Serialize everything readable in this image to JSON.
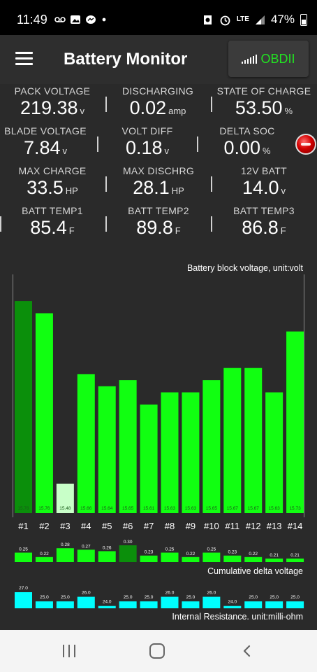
{
  "status_bar": {
    "time": "11:49",
    "left_icons": [
      "voicemail-icon",
      "gallery-icon",
      "messenger-icon",
      "dot-icon"
    ],
    "right_icons": [
      "alarm-icon",
      "alarm-clock-icon",
      "lte-icon",
      "signal-icon"
    ],
    "lte_label": "LTE",
    "battery_percent": "47%"
  },
  "app_bar": {
    "title": "Battery Monitor",
    "obd_button_label": "OBDII",
    "obd_color": "#22e222"
  },
  "stats": {
    "pack_voltage": {
      "label": "PACK VOLTAGE",
      "value": "219.38",
      "unit": "v"
    },
    "discharging": {
      "label": "DISCHARGING",
      "value": "0.02",
      "unit": "amp"
    },
    "state_of_charge": {
      "label": "STATE OF CHARGE",
      "value": "53.50",
      "unit": "%"
    },
    "blade_voltage": {
      "label": "BLADE VOLTAGE",
      "value": "7.84",
      "unit": "v"
    },
    "volt_diff": {
      "label": "VOLT DIFF",
      "value": "0.18",
      "unit": "v"
    },
    "delta_soc": {
      "label": "DELTA SOC",
      "value": "0.00",
      "unit": "%"
    },
    "max_charge": {
      "label": "MAX CHARGE",
      "value": "33.5",
      "unit": "HP"
    },
    "max_dischrg": {
      "label": "MAX DISCHRG",
      "value": "28.1",
      "unit": "HP"
    },
    "batt_12v": {
      "label": "12V BATT",
      "value": "14.0",
      "unit": "v"
    },
    "batt_temp1": {
      "label": "BATT TEMP1",
      "value": "85.4",
      "unit": "F"
    },
    "batt_temp2": {
      "label": "BATT TEMP2",
      "value": "89.8",
      "unit": "F"
    },
    "batt_temp3": {
      "label": "BATT TEMP3",
      "value": "86.8",
      "unit": "F"
    }
  },
  "chart_data": [
    {
      "type": "bar",
      "title": "Battery block voltage, unit:volt",
      "categories": [
        "#1",
        "#2",
        "#3",
        "#4",
        "#5",
        "#6",
        "#7",
        "#8",
        "#9",
        "#10",
        "#11",
        "#12",
        "#13",
        "#14"
      ],
      "values": [
        15.78,
        15.76,
        15.48,
        15.66,
        15.64,
        15.65,
        15.61,
        15.63,
        15.63,
        15.65,
        15.67,
        15.67,
        15.63,
        15.73
      ],
      "value_labels": [
        "15.78",
        "15.76",
        "15.48",
        "15.66",
        "15.64",
        "15.65",
        "15.61",
        "15.63",
        "15.63",
        "15.65",
        "15.67",
        "15.67",
        "15.63",
        "15.73"
      ],
      "ylim": [
        15.45,
        15.81
      ],
      "highlight": {
        "max_index": 0,
        "min_index": 2
      },
      "colors": {
        "normal": "#11ff11",
        "max": "#0b8f0b",
        "min": "#c8ffc8"
      }
    },
    {
      "type": "bar",
      "title": "Cumulative delta voltage",
      "categories": [
        "#1",
        "#2",
        "#3",
        "#4",
        "#5",
        "#6",
        "#7",
        "#8",
        "#9",
        "#10",
        "#11",
        "#12",
        "#13",
        "#14"
      ],
      "values": [
        0.25,
        0.22,
        0.28,
        0.27,
        0.26,
        0.3,
        0.23,
        0.25,
        0.22,
        0.25,
        0.23,
        0.22,
        0.21,
        0.21
      ],
      "value_labels": [
        "0.25",
        "0.22",
        "0.28",
        "0.27",
        "0.26",
        "0.30",
        "0.23",
        "0.25",
        "0.22",
        "0.25",
        "0.23",
        "0.22",
        "0.21",
        "0.21"
      ],
      "ylim": [
        0.2,
        0.3
      ],
      "highlight": {
        "max_index": 5
      },
      "colors": {
        "normal": "#11ff11",
        "max": "#0b8f0b"
      }
    },
    {
      "type": "bar",
      "title": "Internal Resistance. unit:milli-ohm",
      "categories": [
        "#1",
        "#2",
        "#3",
        "#4",
        "#5",
        "#6",
        "#7",
        "#8",
        "#9",
        "#10",
        "#11",
        "#12",
        "#13",
        "#14"
      ],
      "values": [
        27.0,
        25.0,
        25.0,
        26.0,
        24.0,
        25.0,
        25.0,
        26.0,
        25.0,
        26.0,
        24.0,
        25.0,
        25.0,
        25.0
      ],
      "value_labels": [
        "27.0",
        "25.0",
        "25.0",
        "26.0",
        "24.0",
        "25.0",
        "25.0",
        "26.0",
        "25.0",
        "26.0",
        "24.0",
        "25.0",
        "25.0",
        "25.0"
      ],
      "ylim": [
        23.8,
        27.0
      ],
      "colors": {
        "normal": "#00ffff"
      }
    }
  ],
  "nav_bar": {
    "icons": [
      "recent-apps-icon",
      "home-icon",
      "back-icon"
    ]
  }
}
